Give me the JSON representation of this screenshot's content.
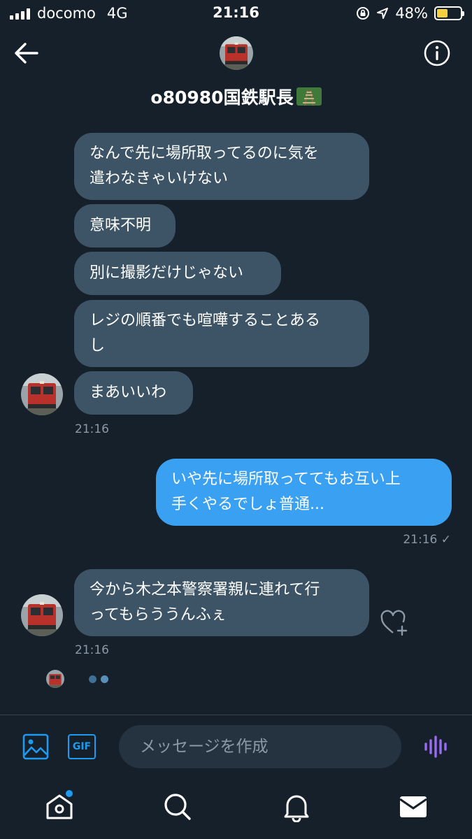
{
  "status_bar": {
    "carrier": "docomo",
    "network": "4G",
    "time": "21:16",
    "battery": "48%",
    "battery_level": 0.48
  },
  "header": {
    "name": "o80980国鉄駅長"
  },
  "messages": [
    {
      "id": "m1",
      "direction": "in",
      "text": "なんで先に場所取ってるのに気を\n遣わなきゃいけない"
    },
    {
      "id": "m2",
      "direction": "in",
      "text": "意味不明"
    },
    {
      "id": "m3",
      "direction": "in",
      "text": "別に撮影だけじゃない"
    },
    {
      "id": "m4",
      "direction": "in",
      "text": "レジの順番でも喧嘩することある\nし"
    },
    {
      "id": "m5",
      "direction": "in",
      "text": "まあいいわ"
    },
    {
      "id": "m6",
      "direction": "out",
      "text": "いや先に場所取っててもお互い上\n手くやるでしょ普通..."
    },
    {
      "id": "m7",
      "direction": "in",
      "text": "今から木之本警察署親に連れて行\nってもらううんふぇ"
    }
  ],
  "timestamps": {
    "group1": "21:16",
    "outgoing": "21:16 ✓",
    "group3": "21:16"
  },
  "composer": {
    "placeholder": "メッセージを作成",
    "gif_label": "GIF"
  },
  "colors": {
    "background": "#15202b",
    "incoming_bubble": "#3d5466",
    "outgoing_bubble": "#3aa0f2",
    "accent": "#1d9bf0",
    "voice_icon": "#9b6bf2"
  },
  "icons": {
    "back": "arrow-left-icon",
    "info": "info-icon",
    "like": "heart-plus-icon",
    "media": "image-icon",
    "gif": "gif-icon",
    "voice": "voice-wave-icon",
    "home": "home-icon",
    "search": "search-icon",
    "notifications": "bell-icon",
    "messages": "mail-icon"
  }
}
